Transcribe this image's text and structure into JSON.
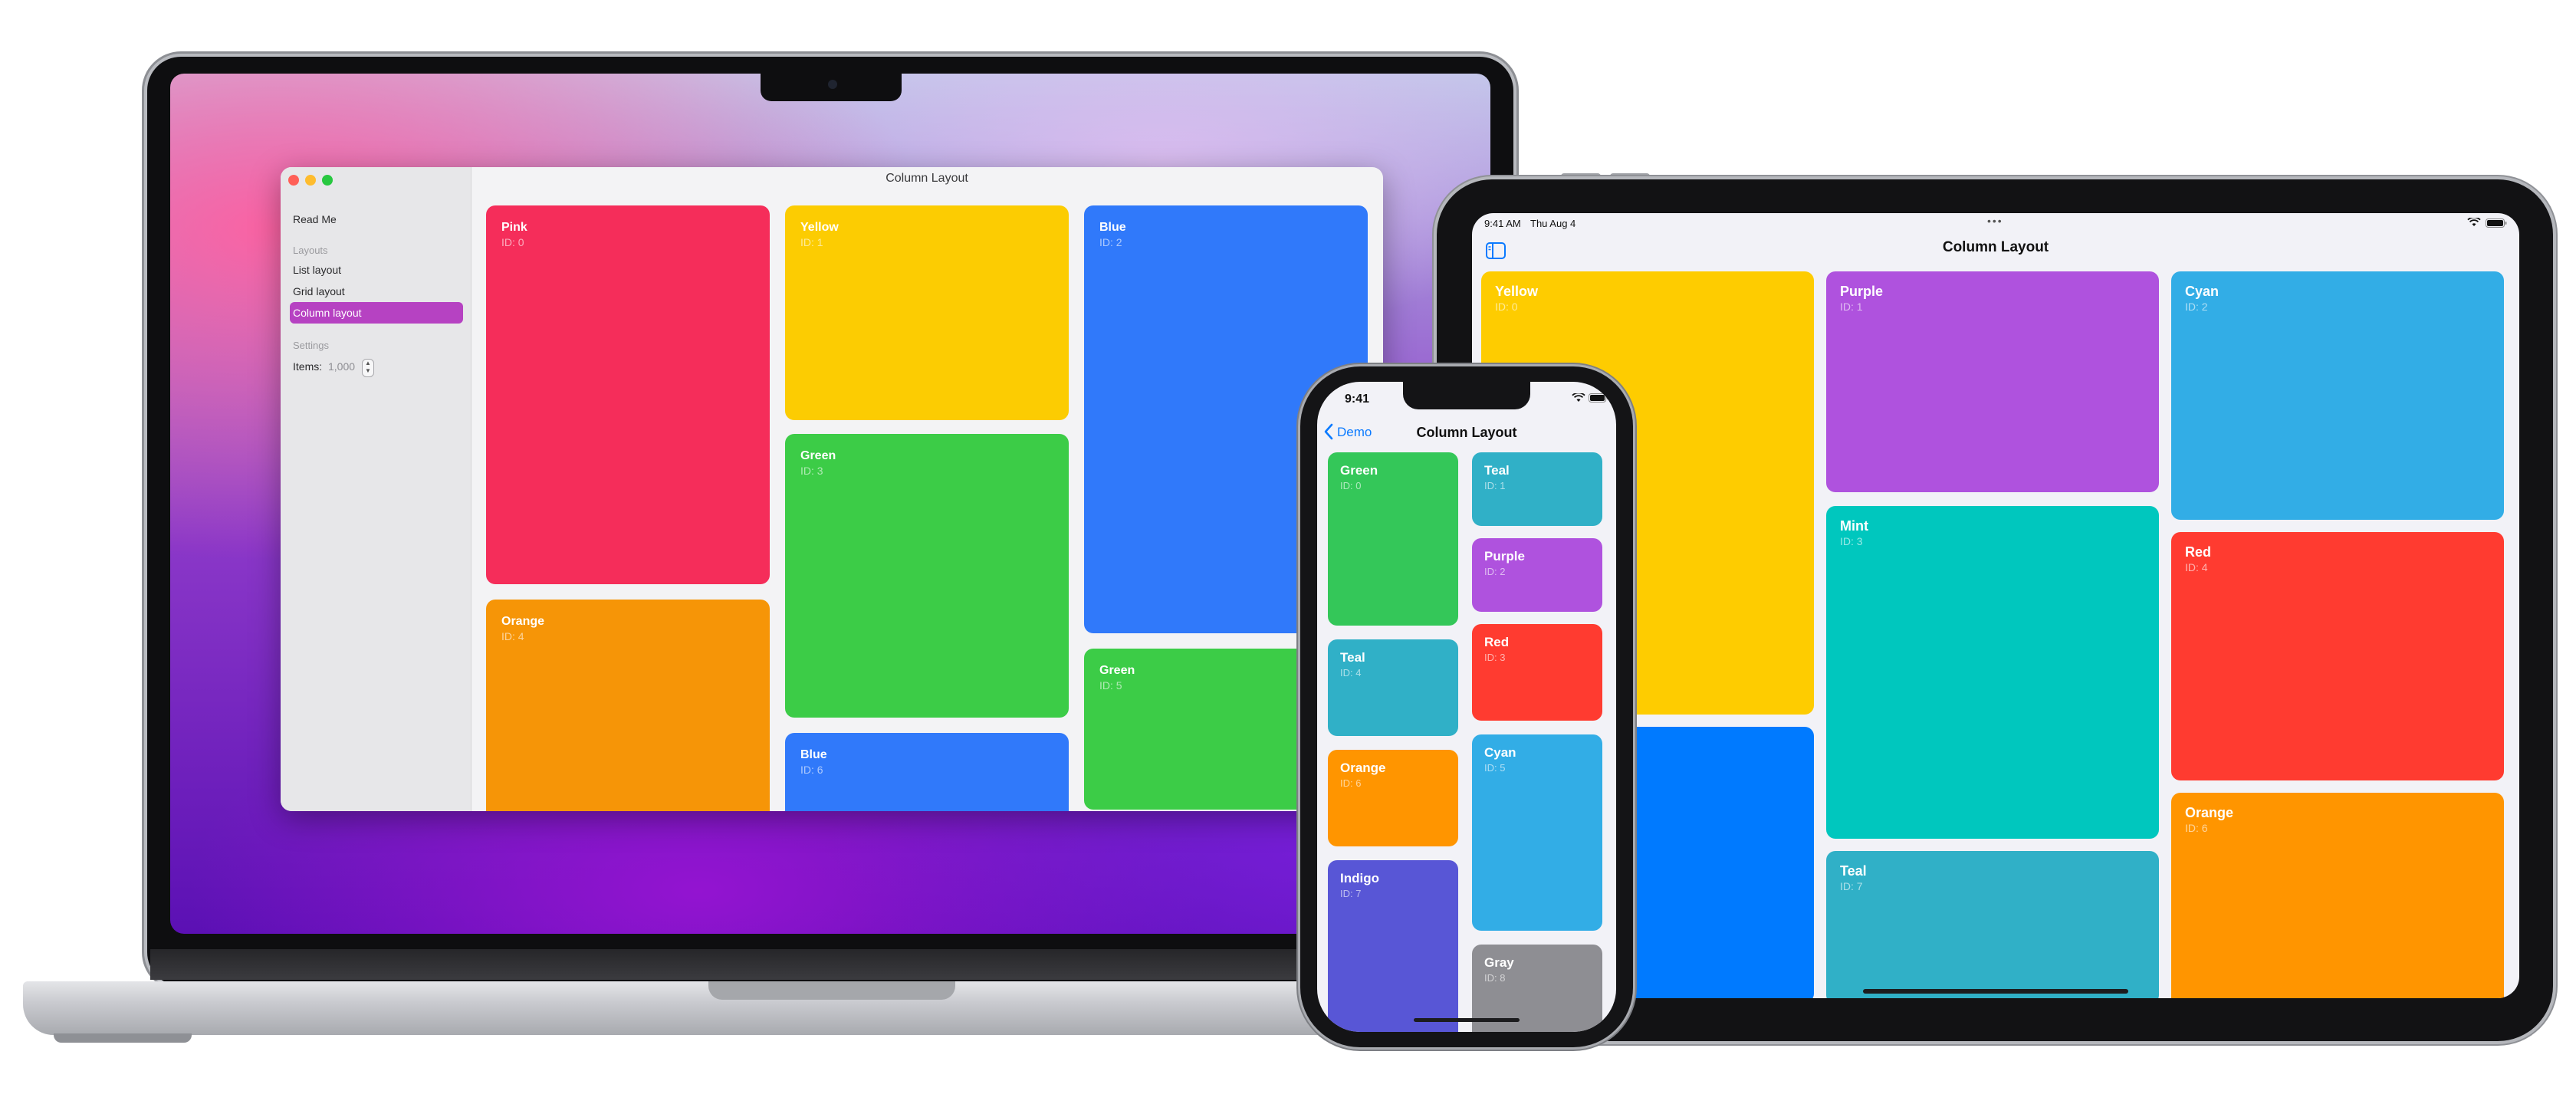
{
  "mac": {
    "window_title": "Column Layout",
    "sidebar": {
      "read_me": "Read Me",
      "layouts_header": "Layouts",
      "items": [
        "List layout",
        "Grid layout",
        "Column layout"
      ],
      "settings_header": "Settings",
      "items_label": "Items:",
      "items_value": "1,000"
    },
    "tiles": [
      {
        "name": "Pink",
        "id": "ID: 0",
        "color": "#f52d5a"
      },
      {
        "name": "Yellow",
        "id": "ID: 1",
        "color": "#fccc02"
      },
      {
        "name": "Blue",
        "id": "ID: 2",
        "color": "#3079fa"
      },
      {
        "name": "Green",
        "id": "ID: 3",
        "color": "#3ccc47"
      },
      {
        "name": "Orange",
        "id": "ID: 4",
        "color": "#f69507"
      },
      {
        "name": "Green",
        "id": "ID: 5",
        "color": "#3ccc47"
      },
      {
        "name": "Blue",
        "id": "ID: 6",
        "color": "#3079fa"
      }
    ]
  },
  "ipad": {
    "time": "9:41 AM",
    "date": "Thu Aug 4",
    "title": "Column Layout",
    "tiles": [
      {
        "name": "Yellow",
        "id": "ID: 0",
        "color": "#fecc00"
      },
      {
        "name": "Purple",
        "id": "ID: 1",
        "color": "#af52de"
      },
      {
        "name": "Cyan",
        "id": "ID: 2",
        "color": "#32ade6"
      },
      {
        "name": "Mint",
        "id": "ID: 3",
        "color": "#00c7be"
      },
      {
        "name": "Red",
        "id": "ID: 4",
        "color": "#ff3b30"
      },
      {
        "name": "Orange",
        "id": "ID: 6",
        "color": "#ff9500"
      },
      {
        "name": "Teal",
        "id": "ID: 7",
        "color": "#30b0c7"
      },
      {
        "name": "",
        "id": "",
        "color": "#007aff"
      }
    ]
  },
  "iphone": {
    "time": "9:41",
    "back_label": "Demo",
    "title": "Column Layout",
    "tiles": [
      {
        "name": "Green",
        "id": "ID: 0",
        "color": "#34c759"
      },
      {
        "name": "Teal",
        "id": "ID: 1",
        "color": "#30b0c7"
      },
      {
        "name": "Purple",
        "id": "ID: 2",
        "color": "#af52de"
      },
      {
        "name": "Red",
        "id": "ID: 3",
        "color": "#ff3b30"
      },
      {
        "name": "Teal",
        "id": "ID: 4",
        "color": "#30b0c7"
      },
      {
        "name": "Cyan",
        "id": "ID: 5",
        "color": "#32ade6"
      },
      {
        "name": "Orange",
        "id": "ID: 6",
        "color": "#ff9500"
      },
      {
        "name": "Indigo",
        "id": "ID: 7",
        "color": "#5856d6"
      },
      {
        "name": "Gray",
        "id": "ID: 8",
        "color": "#8e8e93"
      }
    ]
  }
}
